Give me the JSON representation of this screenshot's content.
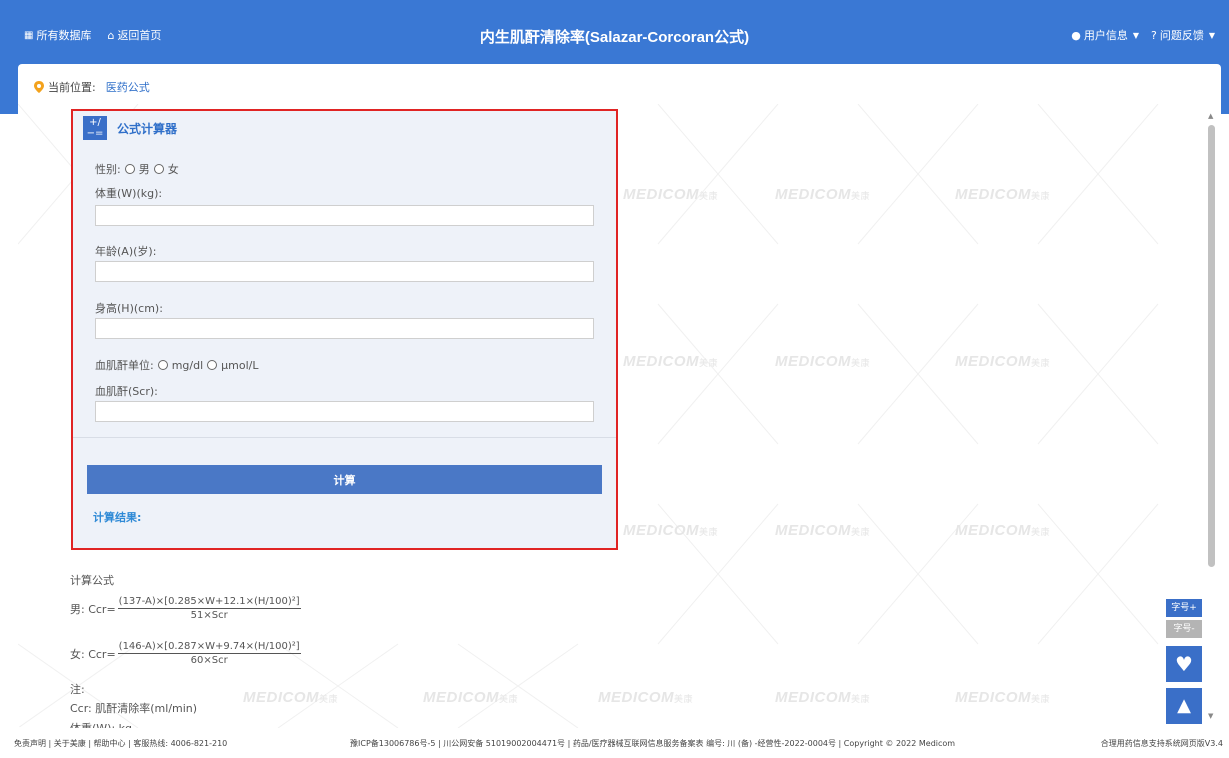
{
  "header": {
    "all_db": "所有数据库",
    "home": "返回首页",
    "title": "内生肌酐清除率(Salazar-Corcoran公式)",
    "user_info": "用户信息",
    "feedback": "问题反馈"
  },
  "breadcrumb": {
    "prefix": "当前位置:",
    "link": "医药公式"
  },
  "watermark": {
    "brand": "MEDICOM",
    "cn": "美康"
  },
  "calculator": {
    "icon_text_top": "+/",
    "icon_text_bottom": "−=",
    "title": "公式计算器",
    "sex_label": "性别:",
    "sex_options": [
      "男",
      "女"
    ],
    "weight_label": "体重(W)(kg):",
    "weight_value": "",
    "age_label": "年龄(A)(岁):",
    "age_value": "",
    "height_label": "身高(H)(cm):",
    "height_value": "",
    "scr_unit_label": "血肌酐单位:",
    "scr_unit_options": [
      "mg/dl",
      "μmol/L"
    ],
    "scr_label": "血肌酐(Scr):",
    "scr_value": "",
    "calc_button": "计算",
    "result_label": "计算结果:"
  },
  "formula": {
    "heading": "计算公式",
    "male_prefix": "男: Ccr=",
    "male_num": "(137-A)×[0.285×W+12.1×(H/100)²]",
    "male_den": "51×Scr",
    "female_prefix": "女: Ccr=",
    "female_num": "(146-A)×[0.287×W+9.74×(H/100)²]",
    "female_den": "60×Scr",
    "note_label": "注:",
    "note_1": "Ccr: 肌酐清除率(ml/min)",
    "note_2": "体重(W): kg"
  },
  "tools": {
    "font_plus": "字号+",
    "font_minus": "字号-"
  },
  "footer": {
    "left": "免责声明 | 关于美康 | 帮助中心 | 客服热线: 4006-821-210",
    "middle": "豫ICP备13006786号-5 | 川公网安备 51019002004471号 | 药品/医疗器械互联网信息服务备案表 编号: 川 (备) -经营性-2022-0004号 | Copyright © 2022 Medicom",
    "right": "合理用药信息支持系统网页版V3.4"
  }
}
